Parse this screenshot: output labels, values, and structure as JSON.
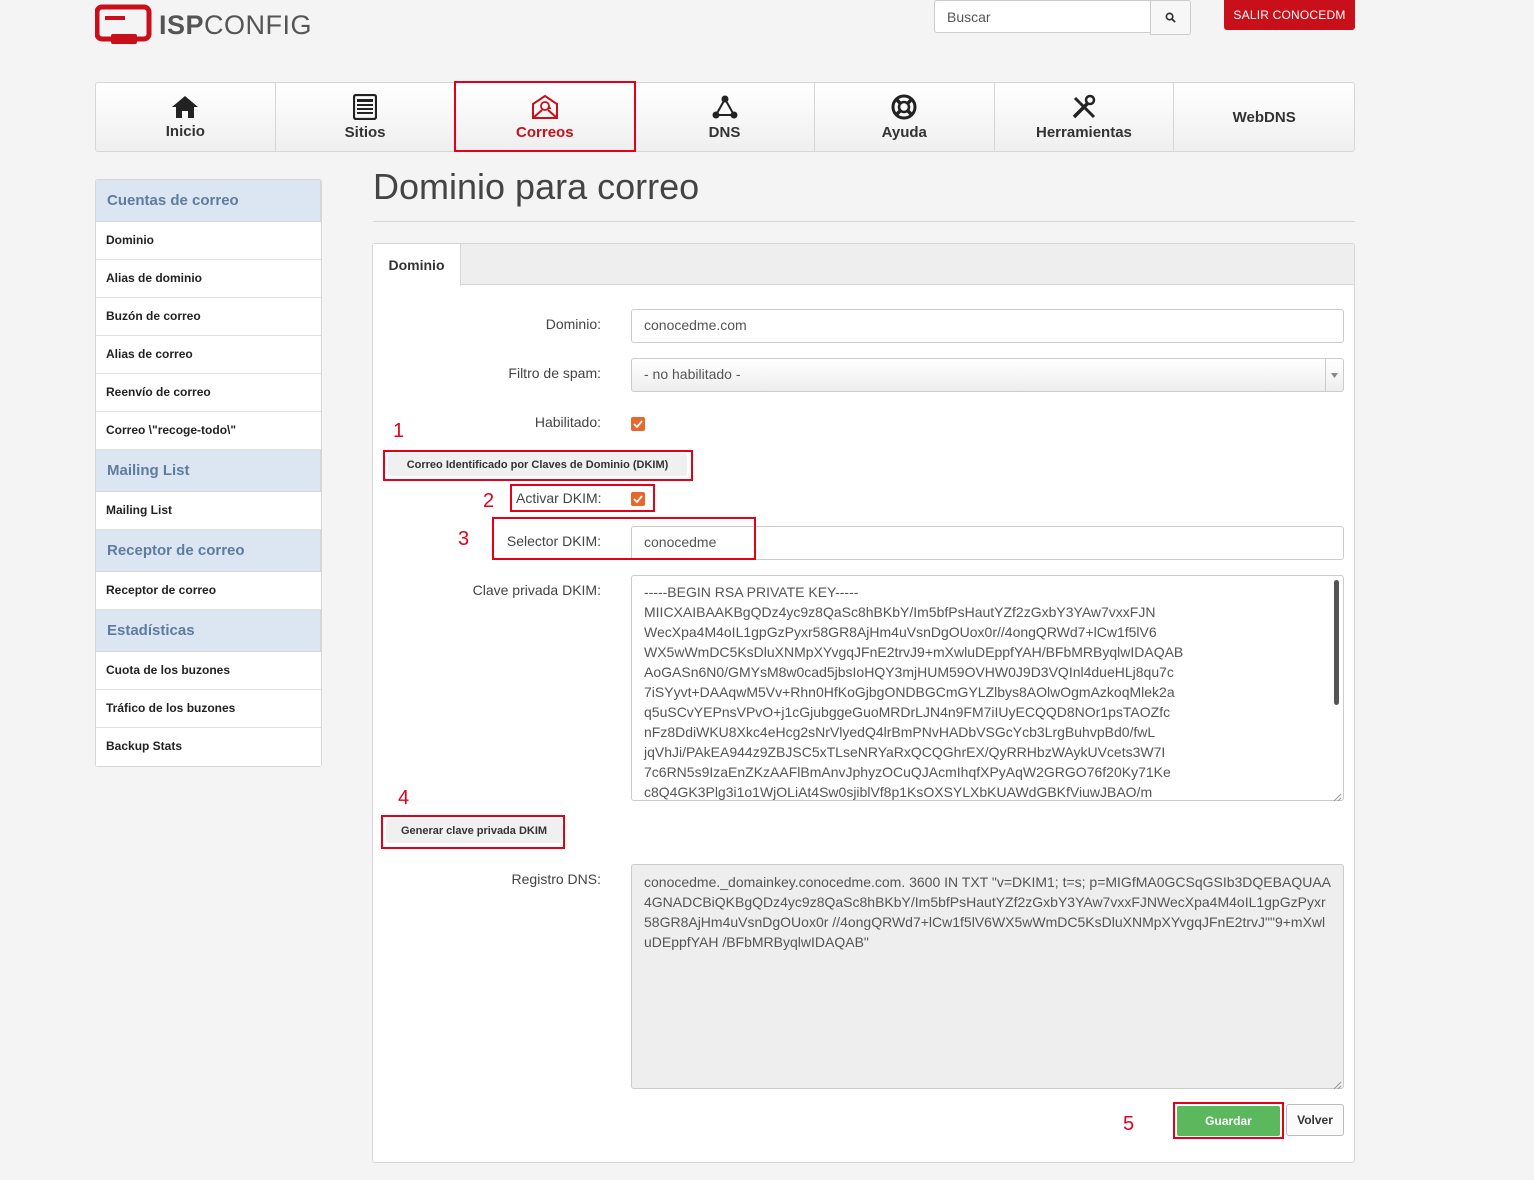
{
  "brand": {
    "logo_bold": "ISP",
    "logo_light": "CONFIG",
    "accent": "#c9101a"
  },
  "header": {
    "search_placeholder": "Buscar",
    "search_icon": "search-icon",
    "logout_label": "SALIR CONOCEDM"
  },
  "topnav": {
    "items": [
      {
        "label": "Inicio",
        "icon": "home-icon"
      },
      {
        "label": "Sitios",
        "icon": "sites-icon"
      },
      {
        "label": "Correos",
        "icon": "mail-icon",
        "active": true
      },
      {
        "label": "DNS",
        "icon": "dns-icon"
      },
      {
        "label": "Ayuda",
        "icon": "help-lifebuoy-icon"
      },
      {
        "label": "Herramientas",
        "icon": "tools-icon"
      },
      {
        "label": "WebDNS"
      }
    ]
  },
  "sidebar": {
    "sections": [
      {
        "title": "Cuentas de correo",
        "items": [
          "Dominio",
          "Alias de dominio",
          "Buzón de correo",
          "Alias de correo",
          "Reenvío de correo",
          "Correo \\\"recoge-todo\\\""
        ]
      },
      {
        "title": "Mailing List",
        "items": [
          "Mailing List"
        ]
      },
      {
        "title": "Receptor de correo",
        "items": [
          "Receptor de correo"
        ]
      },
      {
        "title": "Estadísticas",
        "items": [
          "Cuota de los buzones",
          "Tráfico de los buzones",
          "Backup Stats"
        ]
      }
    ]
  },
  "main": {
    "title": "Dominio para correo",
    "tab": "Dominio",
    "form": {
      "dominio_label": "Dominio:",
      "dominio_value": "conocedme.com",
      "spam_label": "Filtro de spam:",
      "spam_value": "- no habilitado -",
      "habilitado_label": "Habilitado:",
      "habilitado_checked": true,
      "dkim_section_button": "Correo Identificado por Claves de Dominio (DKIM)",
      "activar_dkim_label": "Activar DKIM:",
      "activar_dkim_checked": true,
      "selector_label": "Selector DKIM:",
      "selector_value": "conocedme",
      "private_key_label": "Clave privada DKIM:",
      "private_key_value": "-----BEGIN RSA PRIVATE KEY-----\nMIICXAIBAAKBgQDz4yc9z8QaSc8hBKbY/Im5bfPsHautYZf2zGxbY3YAw7vxxFJN\nWecXpa4M4oIL1gpGzPyxr58GR8AjHm4uVsnDgOUox0r//4ongQRWd7+lCw1f5lV6\nWX5wWmDC5KsDluXNMpXYvgqJFnE2trvJ9+mXwluDEppfYAH/BFbMRByqlwIDAQAB\nAoGASn6N0/GMYsM8w0cad5jbsIoHQY3mjHUM59OVHW0J9D3VQInl4dueHLj8qu7c\n7iSYyvt+DAAqwM5Vv+Rhn0HfKoGjbgONDBGCmGYLZlbys8AOlwOgmAzkoqMlek2a\nq5uSCvYEPnsVPvO+j1cGjubggeGuoMRDrLJN4n9FM7iIUyECQQD8NOr1psTAOZfc\nnFz8DdiWKU8Xkc4eHcg2sNrVlyedQ4lrBmPNvHADbVSGcYcb3LrgBuhvpBd0/fwL\njqVhJi/PAkEA944z9ZBJSC5xTLseNRYaRxQCQGhrEX/QyRRHbzWAykUVcets3W7I\n7c6RN5s9IzaEnZKzAAFlBmAnvJphyzOCuQJAcmIhqfXPyAqW2GRGO76f20Ky71Ke\nc8Q4GK3Plg3i1o1WjOLiAt4Sw0sjiblVf8p1KsOXSYLXbKUAWdGBKfViuwJBAO/m",
      "generate_key_button": "Generar clave privada DKIM",
      "dns_label": "Registro DNS:",
      "dns_value": "conocedme._domainkey.conocedme.com. 3600  IN  TXT   \"v=DKIM1; t=s; p=MIGfMA0GCSqGSIb3DQEBAQUAA4GNADCBiQKBgQDz4yc9z8QaSc8hBKbY/Im5bfPsHautYZf2zGxbY3YAw7vxxFJNWecXpa4M4oIL1gpGzPyxr58GR8AjHm4uVsnDgOUox0r //4ongQRWd7+lCw1f5lV6WX5wWmDC5KsDluXNMpXYvgqJFnE2trvJ\"\"9+mXwluDEppfYAH /BFbMRByqlwIDAQAB\"",
      "save_button": "Guardar",
      "back_button": "Volver"
    }
  },
  "annotations": {
    "markers": [
      "1",
      "2",
      "3",
      "4",
      "5"
    ],
    "color": "#e2001a"
  }
}
